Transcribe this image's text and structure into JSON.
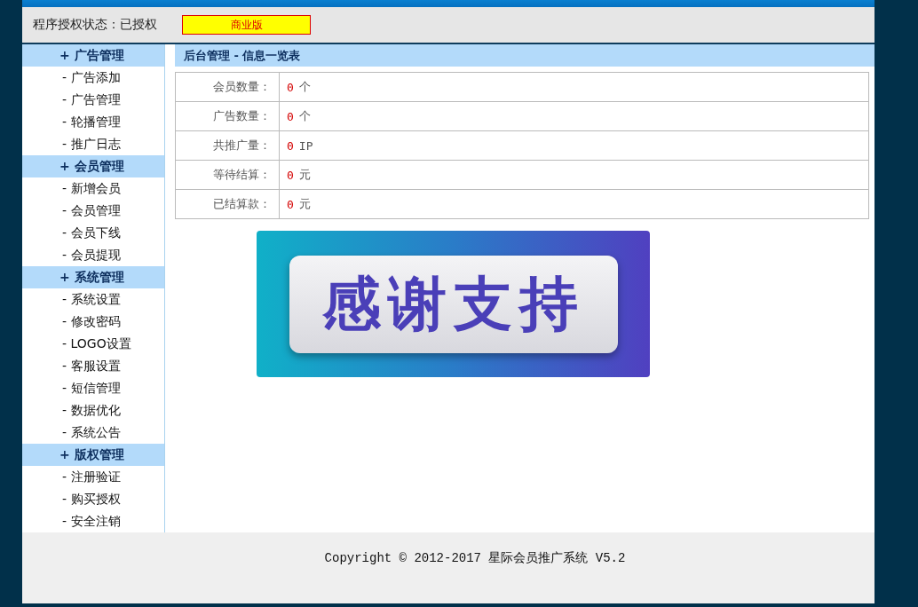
{
  "header": {
    "status_label": "程序授权状态：已授权",
    "edition_badge": "商业版"
  },
  "sidebar": {
    "groups": [
      {
        "title": "+ 广告管理",
        "items": [
          "- 广告添加",
          "- 广告管理",
          "- 轮播管理",
          "- 推广日志"
        ]
      },
      {
        "title": "+ 会员管理",
        "items": [
          "- 新增会员",
          "- 会员管理",
          "- 会员下线",
          "- 会员提现"
        ]
      },
      {
        "title": "+ 系统管理",
        "items": [
          "- 系统设置",
          "- 修改密码",
          "- LOGO设置",
          "- 客服设置",
          "- 短信管理",
          "- 数据优化",
          "- 系统公告"
        ]
      },
      {
        "title": "+ 版权管理",
        "items": [
          "- 注册验证",
          "- 购买授权",
          "- 安全注销"
        ]
      }
    ]
  },
  "content": {
    "title": "后台管理 - 信息一览表",
    "stats": [
      {
        "label": "会员数量：",
        "value": "0",
        "unit": "个"
      },
      {
        "label": "广告数量：",
        "value": "0",
        "unit": "个"
      },
      {
        "label": "共推广量：",
        "value": "0",
        "unit": "IP"
      },
      {
        "label": "等待结算：",
        "value": "0",
        "unit": "元"
      },
      {
        "label": "已结算款：",
        "value": "0",
        "unit": "元"
      }
    ],
    "banner": {
      "text": "感谢支持"
    }
  },
  "footer": {
    "copyright": "Copyright © 2012-2017 星际会员推广系统 V5.2"
  }
}
